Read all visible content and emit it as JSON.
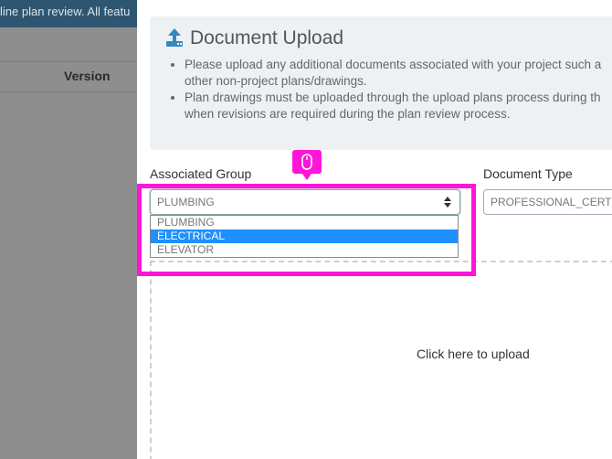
{
  "background": {
    "banner_text": "line plan review. All featu",
    "column_header": "Version"
  },
  "upload": {
    "title": "Document Upload",
    "notes": [
      "Please upload any additional documents associated with your project such a",
      "other non-project plans/drawings.",
      "Plan drawings must be uploaded through the upload plans process during th",
      "when revisions are required during the plan review process."
    ]
  },
  "form": {
    "associated_group_label": "Associated Group",
    "associated_group_value": "PLUMBING",
    "associated_group_options": [
      "PLUMBING",
      "ELECTRICAL",
      "ELEVATOR"
    ],
    "associated_group_highlighted": "ELECTRICAL",
    "document_type_label": "Document Type",
    "document_type_value": "PROFESSIONAL_CERTIF"
  },
  "dropzone": {
    "text": "Click here to upload"
  },
  "colors": {
    "highlight": "#ff15d8",
    "selected_option": "#1e90ff",
    "upload_icon": "#2e8bc0"
  },
  "icons": {
    "upload": "upload-icon",
    "mouse": "mouse-icon",
    "select_arrows": "sort-arrows-icon"
  }
}
